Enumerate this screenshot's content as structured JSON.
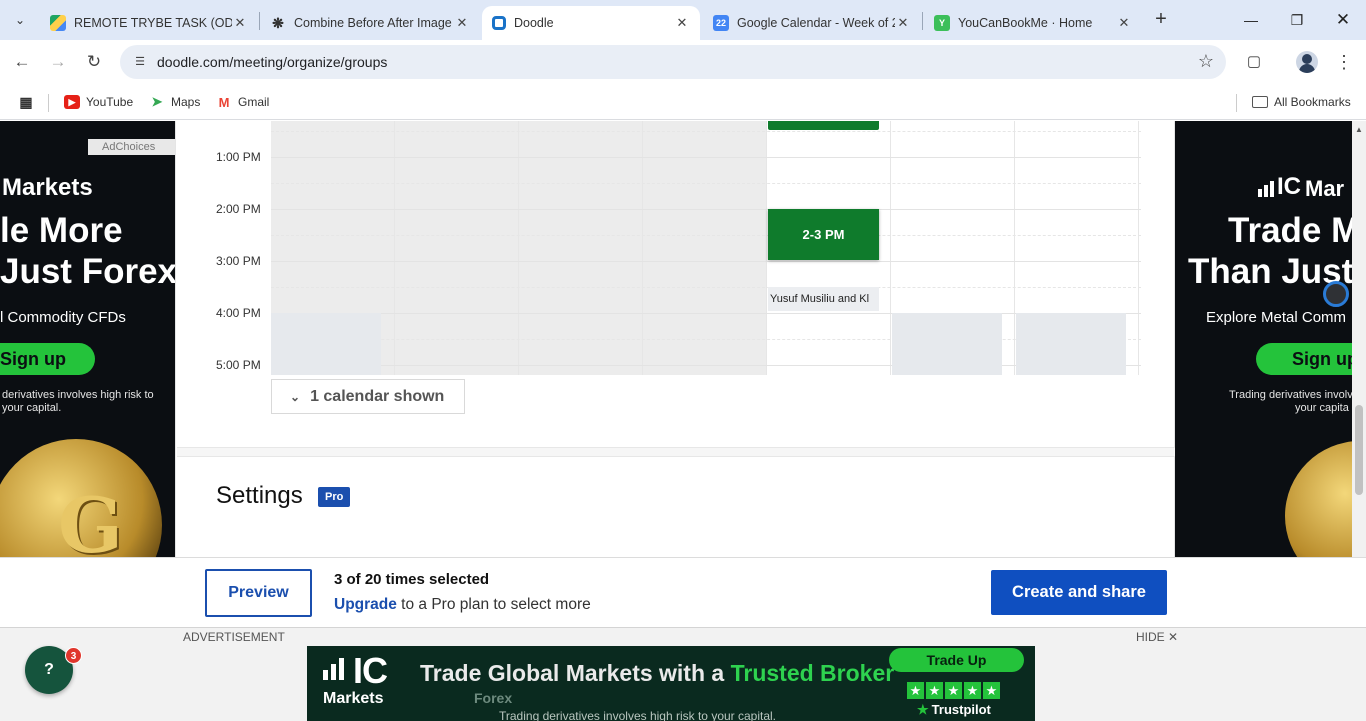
{
  "browser": {
    "tabs": [
      {
        "title": "REMOTE TRYBE TASK (ODUY",
        "favicon": "drive-icon"
      },
      {
        "title": "Combine Before After Image",
        "favicon": "openai-icon"
      },
      {
        "title": "Doodle",
        "favicon": "doodle-icon",
        "active": true
      },
      {
        "title": "Google Calendar - Week of 2",
        "favicon": "calendar-icon",
        "badge": "22"
      },
      {
        "title": "YouCanBookMe · Home",
        "favicon": "ycbm-icon",
        "badge": "Y"
      }
    ],
    "url": "doodle.com/meeting/organize/groups",
    "bookmarks": [
      {
        "label": "YouTube",
        "icon": "youtube-icon"
      },
      {
        "label": "Maps",
        "icon": "maps-icon"
      },
      {
        "label": "Gmail",
        "icon": "gmail-icon"
      }
    ],
    "all_bookmarks": "All Bookmarks"
  },
  "calendar": {
    "times": [
      "1:00 PM",
      "2:00 PM",
      "3:00 PM",
      "4:00 PM",
      "5:00 PM"
    ],
    "selected_event": "2-3 PM",
    "busy_event": "Yusuf Musiliu and Kl",
    "toggle_label": "1 calendar shown"
  },
  "settings": {
    "title": "Settings",
    "badge": "Pro"
  },
  "footer": {
    "preview": "Preview",
    "selection": "3 of 20 times selected",
    "upgrade_link": "Upgrade",
    "upgrade_rest": " to a Pro plan to select more",
    "create": "Create and share"
  },
  "ads": {
    "left": {
      "adchoices": "AdChoices",
      "brand": "Markets",
      "line1": "le More",
      "line2": "Just Forex",
      "line3": "l Commodity CFDs",
      "cta": "Sign up",
      "disc1": "derivatives involves high risk to",
      "disc2": "your capital.",
      "coin": "G"
    },
    "right": {
      "brand_ic": "IC",
      "brand": "Mar",
      "line1": "Trade M",
      "line2": "Than Just",
      "line3": "Explore Metal Comm",
      "cta": "Sign up",
      "disc1": "Trading derivatives involv",
      "disc2": "your capita"
    },
    "bottom": {
      "label": "ADVERTISEMENT",
      "hide": "HIDE",
      "ic": "IC",
      "markets": "Markets",
      "headline_a": "Trade Global Markets ",
      "headline_b": "with a ",
      "headline_c": "Trusted Broker",
      "forex": "Forex",
      "disclaimer": "Trading derivatives involves high risk to your capital.",
      "trade_up": "Trade Up",
      "trustpilot": "Trustpilot"
    }
  },
  "help": {
    "label": "?",
    "badge": "3"
  },
  "colors": {
    "event_green": "#0f7b2c",
    "doodle_blue": "#0f4fc0",
    "ad_green": "#24c33b"
  }
}
